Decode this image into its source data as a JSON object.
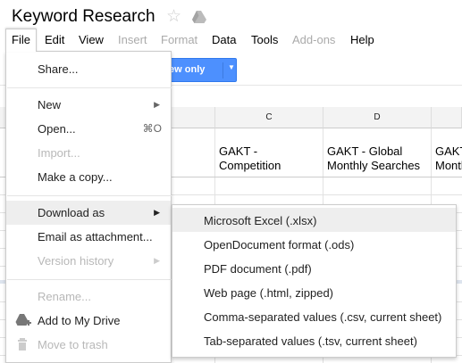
{
  "document": {
    "title": "Keyword Research"
  },
  "icons": {
    "star": "star-icon",
    "drive": "drive-icon",
    "add_to_drive": "add-to-drive-icon",
    "trash": "trash-icon"
  },
  "menubar": {
    "file": "File",
    "edit": "Edit",
    "view": "View",
    "insert": "Insert",
    "format": "Format",
    "data": "Data",
    "tools": "Tools",
    "addons": "Add-ons",
    "help": "Help"
  },
  "toolbar": {
    "view_only_label": "iew only"
  },
  "sheet": {
    "columns": [
      "C",
      "D"
    ],
    "cells": {
      "c1": "GAKT - Competition",
      "d1": "GAKT - Global Monthly Searches",
      "e1": "GAKT Month"
    }
  },
  "file_menu": {
    "items": [
      {
        "label": "Share...",
        "enabled": true
      },
      {
        "label": "New",
        "enabled": true,
        "submenu": true
      },
      {
        "label": "Open...",
        "enabled": true,
        "shortcut": "⌘O"
      },
      {
        "label": "Import...",
        "enabled": false
      },
      {
        "label": "Make a copy...",
        "enabled": true
      },
      {
        "label": "Download as",
        "enabled": true,
        "submenu": true,
        "highlighted": true
      },
      {
        "label": "Email as attachment...",
        "enabled": true
      },
      {
        "label": "Version history",
        "enabled": false,
        "submenu": true
      },
      {
        "label": "Rename...",
        "enabled": false
      },
      {
        "label": "Add to My Drive",
        "enabled": true
      },
      {
        "label": "Move to trash",
        "enabled": false
      }
    ]
  },
  "download_submenu": {
    "items": [
      {
        "label": "Microsoft Excel (.xlsx)",
        "highlighted": true
      },
      {
        "label": "OpenDocument format (.ods)"
      },
      {
        "label": "PDF document (.pdf)"
      },
      {
        "label": "Web page (.html, zipped)"
      },
      {
        "label": "Comma-separated values (.csv, current sheet)"
      },
      {
        "label": "Tab-separated values (.tsv, current sheet)"
      }
    ]
  },
  "colors": {
    "accent_button": "#4d90fe",
    "menu_highlight": "#eeeeee",
    "disabled_text": "#b8b8b8"
  }
}
